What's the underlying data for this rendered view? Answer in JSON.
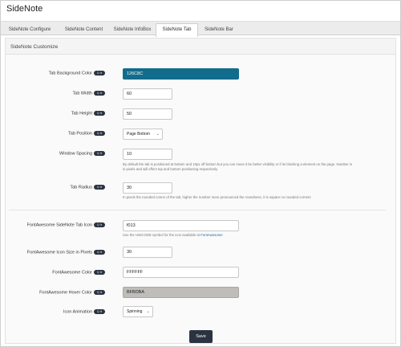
{
  "app": {
    "title": "SideNote"
  },
  "tabs": [
    {
      "label": "SideNote Configure"
    },
    {
      "label": "SideNote Content"
    },
    {
      "label": "SideNote InfoBox"
    },
    {
      "label": "SideNote Tab"
    },
    {
      "label": "SideNote Bar"
    }
  ],
  "section": {
    "title": "SideNote Customize"
  },
  "badge_label": "Q It",
  "fields": {
    "tab_bg_color": {
      "label": "Tab Background Color",
      "value": "126C8C"
    },
    "tab_width": {
      "label": "Tab Width",
      "value": "60"
    },
    "tab_height": {
      "label": "Tab Height",
      "value": "50"
    },
    "tab_position": {
      "label": "Tab Position",
      "value": "Page Bottom"
    },
    "window_spacing": {
      "label": "Window Spacing",
      "value": "10",
      "help_line1": "By default the tab is positioned at bottom and 10px off bottom but you can move it be better visibility or if its blocking a element on the page. Number is",
      "help_line2": "in pixels and will effect top and bottom positioning respectively"
    },
    "tab_radius": {
      "label": "Tab Radius",
      "value": "30",
      "help": "In pixels the rounded corers of the tab, higher the number more pronounced the roundness, 0 is square no rounded corners"
    },
    "fa_icon": {
      "label": "FontAwesome SideNote Tab Icon",
      "value": "f013",
      "help_prefix": "Use the UNICODE symbol for the icon available at ",
      "help_link": "FontAwesome"
    },
    "fa_icon_size": {
      "label": "FontAwesome Icon Size in Pixels",
      "value": "30"
    },
    "fa_color": {
      "label": "FontAwesome Color",
      "value": "FFFFFF"
    },
    "fa_hover_color": {
      "label": "FontAwesome Hover Color",
      "value": "BFBDBA"
    },
    "icon_animation": {
      "label": "Icon Animation",
      "value": "Spinning"
    }
  },
  "save_label": "Save",
  "colors": {
    "tab_bg": "#126c8c",
    "hover": "#bfbdba",
    "button": "#2a3340"
  }
}
